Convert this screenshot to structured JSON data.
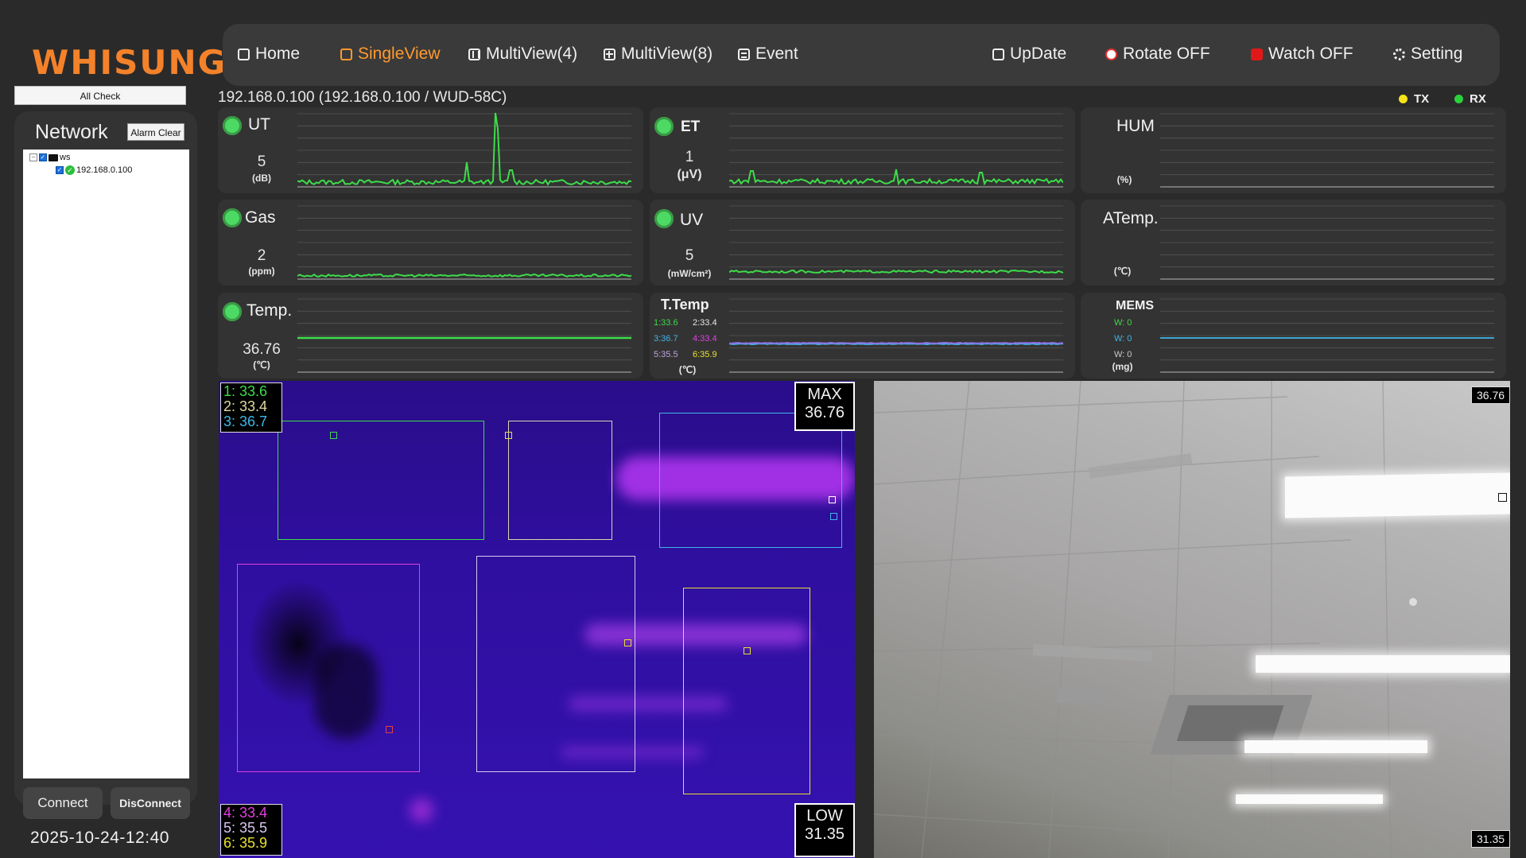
{
  "brand": "WHISUNG",
  "sidebar": {
    "all_check": "All Check",
    "network_title": "Network",
    "alarm_clear": "Alarm Clear",
    "tree": {
      "root": "ws",
      "child": "192.168.0.100"
    },
    "connect": "Connect",
    "disconnect": "DisConnect",
    "datetime": "2025-10-24-12:40"
  },
  "toolbar": {
    "home": "Home",
    "singleview": "SingleView",
    "multiview4": "MultiView(4)",
    "multiview8": "MultiView(8)",
    "event": "Event",
    "update": "UpDate",
    "rotate": "Rotate OFF",
    "watch": "Watch OFF",
    "setting": "Setting",
    "active_tab": "SingleView"
  },
  "device_title": "192.168.0.100 (192.168.0.100 / WUD-58C)",
  "legend": {
    "tx": "TX",
    "rx": "RX",
    "tx_color": "#f5e31a",
    "rx_color": "#2bd13b"
  },
  "sensors": {
    "ut": {
      "name": "UT",
      "value": "5",
      "unit": "(dB)",
      "active": true
    },
    "et": {
      "name": "ET",
      "value": "1",
      "unit": "(μV)",
      "active": true
    },
    "hum": {
      "name": "HUM",
      "value": "",
      "unit": "(%)",
      "active": false
    },
    "gas": {
      "name": "Gas",
      "value": "2",
      "unit": "(ppm)",
      "active": true
    },
    "uv": {
      "name": "UV",
      "value": "5",
      "unit": "(mW/cm²)",
      "active": true
    },
    "atemp": {
      "name": "ATemp.",
      "value": "",
      "unit": "(℃)",
      "active": false
    },
    "temp": {
      "name": "Temp.",
      "value": "36.76",
      "unit": "(℃)",
      "active": true
    },
    "ttemp": {
      "name": "T.Temp",
      "unit": "(℃)",
      "readings": [
        "1:33.6",
        "2:33.4",
        "3:36.7",
        "4:33.4",
        "5:35.5",
        "6:35.9"
      ],
      "colors": [
        "#3ddc4a",
        "#f0f0f0",
        "#3fb6e8",
        "#e040e0",
        "#c0a0e0",
        "#e8e030"
      ]
    },
    "mems": {
      "name": "MEMS",
      "unit": "(mg)",
      "readings": [
        "W: 0",
        "W: 0",
        "W: 0"
      ],
      "colors": [
        "#3ddc4a",
        "#3fb6e8",
        "#c8c8c8"
      ]
    }
  },
  "thermal": {
    "max_label": "MAX",
    "max_value": "36.76",
    "low_label": "LOW",
    "low_value": "31.35",
    "roi_top": [
      {
        "label": "1:",
        "value": "33.6",
        "color": "#3ddc4a"
      },
      {
        "label": "2:",
        "value": "33.4",
        "color": "#e0d8a0"
      },
      {
        "label": "3:",
        "value": "36.7",
        "color": "#3fb6e8"
      }
    ],
    "roi_bottom": [
      {
        "label": "4:",
        "value": "33.4",
        "color": "#e040e0"
      },
      {
        "label": "5:",
        "value": "35.5",
        "color": "#d8c8f0"
      },
      {
        "label": "6:",
        "value": "35.9",
        "color": "#e8e030"
      }
    ]
  },
  "camera": {
    "max_tag": "36.76",
    "low_tag": "31.35"
  }
}
